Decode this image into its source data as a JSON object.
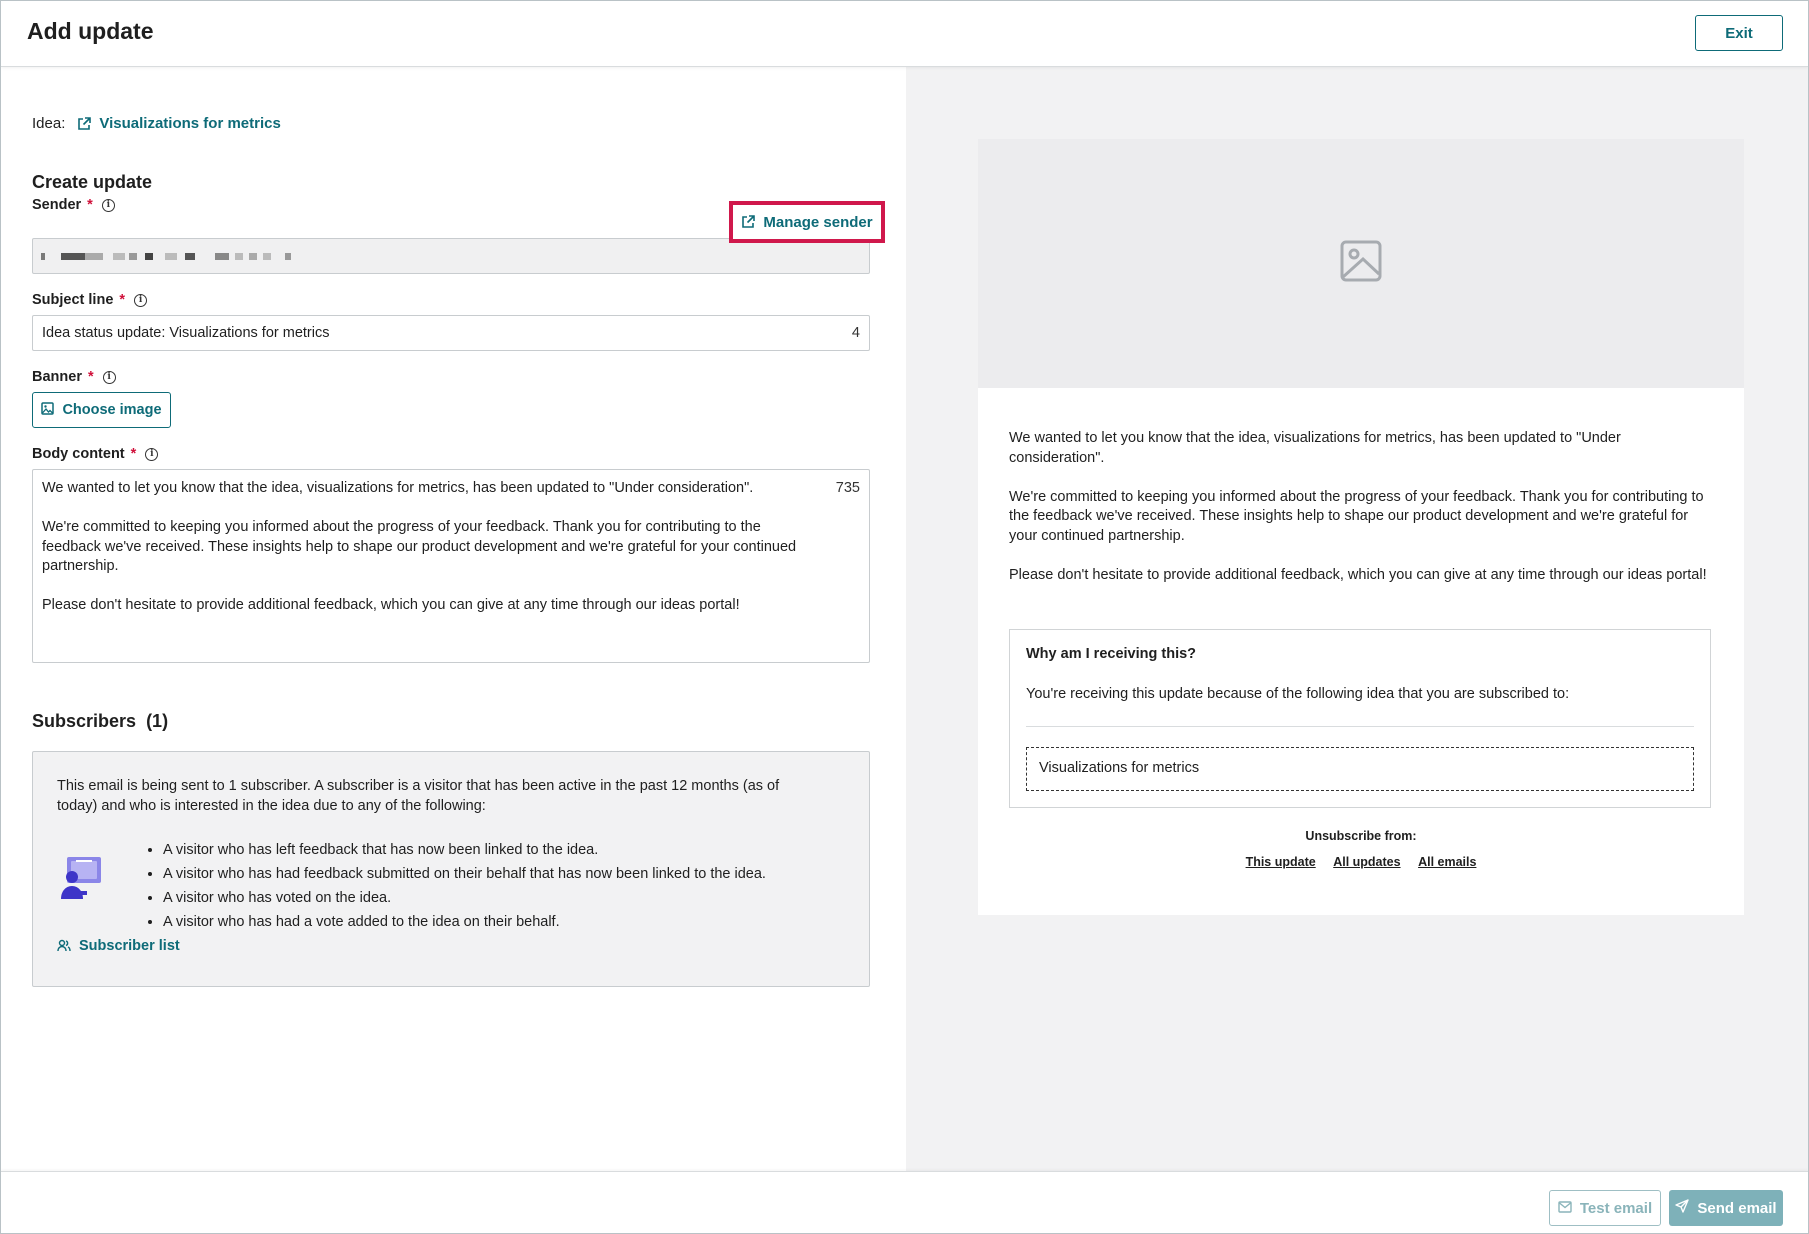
{
  "header": {
    "title": "Add update",
    "exit_label": "Exit"
  },
  "form": {
    "idea_label": "Idea:",
    "idea_name": "Visualizations for metrics",
    "section_title": "Create update",
    "sender_label": "Sender",
    "manage_sender_label": "Manage sender",
    "subject_label": "Subject line",
    "subject_value": "Idea status update: Visualizations for metrics",
    "subject_counter": "4",
    "banner_label": "Banner",
    "choose_image_label": "Choose image",
    "body_label": "Body content",
    "body_counter": "735",
    "body_paragraphs": [
      "We wanted to let you know that the idea, visualizations for metrics, has been updated to \"Under consideration\".",
      "We're committed to keeping you informed about the progress of your feedback. Thank you for contributing to the feedback we've received. These insights help to shape our product development and we're grateful for your continued partnership.",
      "Please don't hesitate to provide additional feedback, which you can give at any time through our ideas portal!"
    ]
  },
  "subscribers": {
    "title": "Subscribers",
    "count": "(1)",
    "intro": "This email is being sent to 1 subscriber. A subscriber is a visitor that has been active in the past 12 months (as of today) and who is interested in the idea due to any of the following:",
    "reasons": [
      "A visitor who has left feedback that has now been linked to the idea.",
      "A visitor who has had feedback submitted on their behalf that has now been linked to the idea.",
      "A visitor who has voted on the idea.",
      "A visitor who has had a vote added to the idea on their behalf."
    ],
    "list_link": "Subscriber list"
  },
  "preview": {
    "paragraphs": [
      "We wanted to let you know that the idea, visualizations for metrics, has been updated to \"Under consideration\".",
      "We're committed to keeping you informed about the progress of your feedback. Thank you for contributing to the feedback we've received. These insights help to shape our product development and we're grateful for your continued partnership.",
      "Please don't hesitate to provide additional feedback, which you can give at any time through our ideas portal!"
    ],
    "why_title": "Why am I receiving this?",
    "why_desc": "You're receiving this update because of the following idea that you are subscribed to:",
    "why_idea": "Visualizations for metrics",
    "unsubscribe_heading": "Unsubscribe from:",
    "unsubscribe_links": [
      "This update",
      "All updates",
      "All emails"
    ]
  },
  "footer": {
    "test_email": "Test email",
    "send_email": "Send email"
  },
  "colors": {
    "accent": "#0e6b78",
    "required": "#d0103a",
    "highlight": "#d0184c"
  }
}
